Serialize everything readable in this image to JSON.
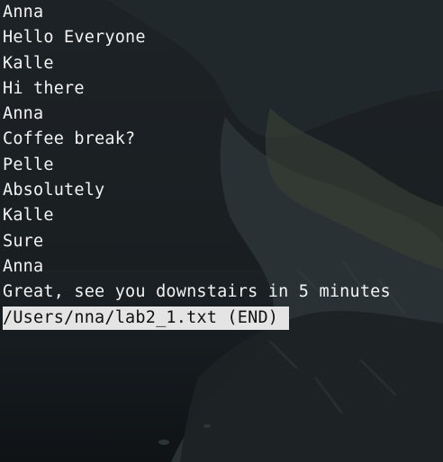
{
  "pager": {
    "lines": [
      "Anna",
      "Hello Everyone",
      "Kalle",
      "Hi there",
      "Anna",
      "Coffee break?",
      "Pelle",
      "Absolutely",
      "Kalle",
      "Sure",
      "Anna",
      "Great, see you downstairs in 5 minutes"
    ],
    "status_line": "/Users/nna/lab2_1.txt (END)"
  },
  "colors": {
    "text": "#f2f2f2",
    "status_bg": "#e4e4e4",
    "status_text": "#101010",
    "background": "#14181b"
  }
}
